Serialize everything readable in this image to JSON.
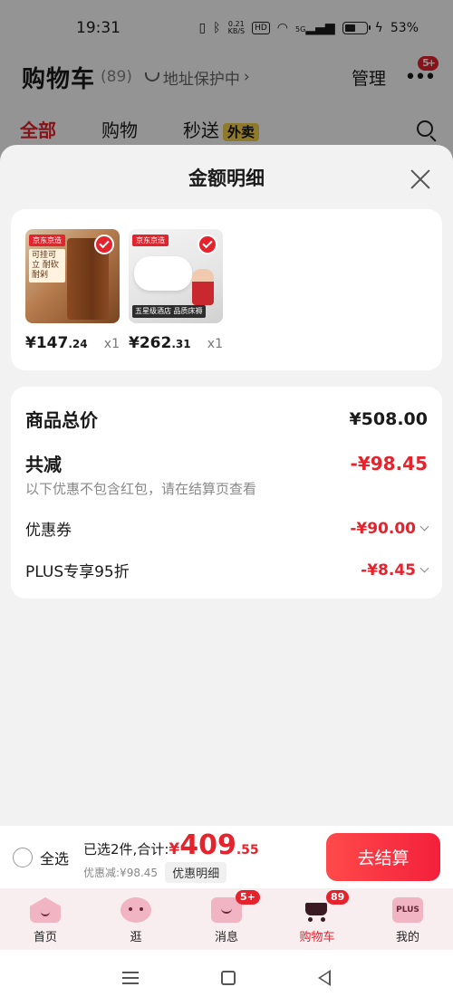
{
  "status": {
    "time": "19:31",
    "net_speed": "0.21",
    "net_unit": "KB/S",
    "hd": "HD",
    "signal": "5G",
    "battery": "53%",
    "battery_level": 0.53
  },
  "cart_header": {
    "title": "购物车",
    "count": "(89)",
    "address": "地址保护中",
    "manage": "管理",
    "more_badge": "5+"
  },
  "tabs": [
    {
      "label": "全部",
      "active": true
    },
    {
      "label": "购物",
      "active": false
    },
    {
      "label": "秒送",
      "active": false,
      "tag": "外卖"
    }
  ],
  "sheet": {
    "title": "金额明细",
    "products": [
      {
        "price_int": "¥147",
        "price_dec": ".24",
        "qty": "x1",
        "brand": "京东京造",
        "note": "可挂可立 耐砍耐剁"
      },
      {
        "price_int": "¥262",
        "price_dec": ".31",
        "qty": "x1",
        "brand": "京东京造",
        "caption": "五星级酒店 品质床褥"
      }
    ],
    "breakdown": {
      "total_label": "商品总价",
      "total_value": "¥508.00",
      "reduce_label": "共减",
      "reduce_value": "-¥98.45",
      "note": "以下优惠不包含红包，请在结算页查看",
      "coupon_label": "优惠券",
      "coupon_value": "-¥90.00",
      "plus_label": "PLUS专享95折",
      "plus_value": "-¥8.45"
    }
  },
  "checkout": {
    "select_all": "全选",
    "selected_text": "已选2件,合计:",
    "total_yen": "¥",
    "total_int": "409",
    "total_dec": ".55",
    "discount_text": "优惠减:¥98.45",
    "detail_button": "优惠明细",
    "checkout_button": "去结算"
  },
  "tabbar": [
    {
      "label": "首页",
      "icon": "home-icon"
    },
    {
      "label": "逛",
      "icon": "browse-icon"
    },
    {
      "label": "消息",
      "icon": "message-icon",
      "badge": "5+"
    },
    {
      "label": "购物车",
      "icon": "cart-icon",
      "badge": "89",
      "active": true
    },
    {
      "label": "我的",
      "icon": "plus-member-icon",
      "icon_text": "PLUS"
    }
  ],
  "colors": {
    "accent": "#e4232d",
    "overlay": "rgba(0,0,0,0.42)",
    "sheet_bg": "#f2f2f2"
  }
}
